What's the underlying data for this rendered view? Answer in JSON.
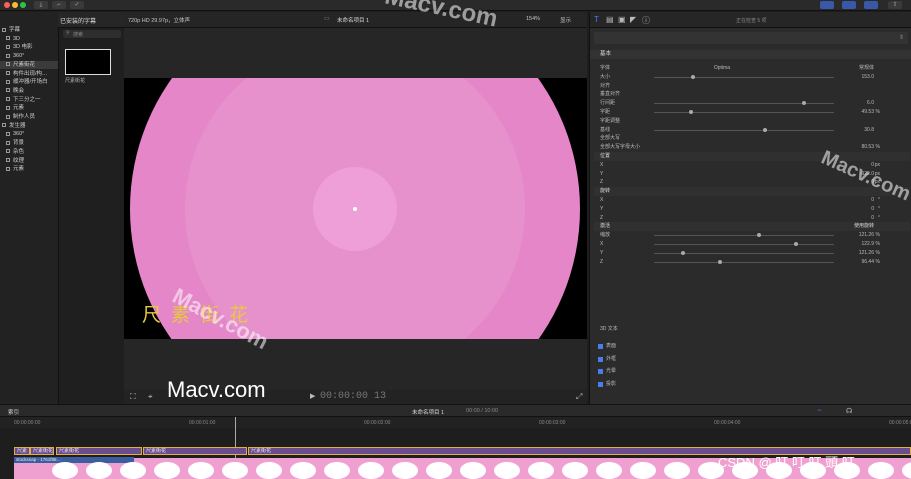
{
  "window": {
    "title": "未命名项目 1",
    "subtitle": "720p HD 29.97p，立体声",
    "zoom": "154%",
    "display_label": "显示",
    "inspector_status": "正在检查 5 项"
  },
  "browser": {
    "library_label": "已安装的字幕",
    "search_placeholder": "搜索",
    "clip_name": "尺素街花"
  },
  "sidebar": {
    "items": [
      {
        "label": "字幕",
        "selected": false,
        "indent": 0
      },
      {
        "label": "3D",
        "selected": false,
        "indent": 1
      },
      {
        "label": "3D 电影",
        "selected": false,
        "indent": 1
      },
      {
        "label": "360°",
        "selected": false,
        "indent": 1
      },
      {
        "label": "尺素街花",
        "selected": true,
        "indent": 1
      },
      {
        "label": "构件出现/构…",
        "selected": false,
        "indent": 1
      },
      {
        "label": "缓冲器/开场白",
        "selected": false,
        "indent": 1
      },
      {
        "label": "晚会",
        "selected": false,
        "indent": 1
      },
      {
        "label": "下三分之一",
        "selected": false,
        "indent": 1
      },
      {
        "label": "元素",
        "selected": false,
        "indent": 1
      },
      {
        "label": "制作人员",
        "selected": false,
        "indent": 1
      },
      {
        "label": "发生器",
        "selected": false,
        "indent": 0
      },
      {
        "label": "360°",
        "selected": false,
        "indent": 1
      },
      {
        "label": "背景",
        "selected": false,
        "indent": 1
      },
      {
        "label": "杂色",
        "selected": false,
        "indent": 1
      },
      {
        "label": "纹理",
        "selected": false,
        "indent": 1
      },
      {
        "label": "元素",
        "selected": false,
        "indent": 1
      }
    ]
  },
  "viewer": {
    "caption": "尺 素 街 花",
    "timecode": "00:00:00 13"
  },
  "inspector": {
    "section_basic": "基本",
    "rows": [
      {
        "label": "字体",
        "value": "Optima",
        "value2": "常规体"
      },
      {
        "label": "大小",
        "value": "153.0",
        "unit": ""
      },
      {
        "label": "对齐",
        "value": "",
        "unit": ""
      },
      {
        "label": "垂直对齐",
        "value": "",
        "unit": ""
      },
      {
        "label": "行间距",
        "value": "6.0",
        "unit": ""
      },
      {
        "label": "字距",
        "value": "49.53",
        "unit": "%"
      },
      {
        "label": "字距调整",
        "value": "",
        "unit": ""
      },
      {
        "label": "基线",
        "value": "30.8",
        "unit": ""
      },
      {
        "label": "全部大写",
        "value": "",
        "unit": ""
      },
      {
        "label": "全部大写字母大小",
        "value": "80.53",
        "unit": "%"
      },
      {
        "label": "位置",
        "value": "",
        "unit": ""
      },
      {
        "label": "X",
        "value": "0",
        "unit": "px"
      },
      {
        "label": "Y",
        "value": "-922.0",
        "unit": "px"
      },
      {
        "label": "Z",
        "value": "0",
        "unit": "px"
      },
      {
        "label": "旋转",
        "value": "",
        "unit": ""
      },
      {
        "label": "X",
        "value": "0",
        "unit": "°"
      },
      {
        "label": "Y",
        "value": "0",
        "unit": "°"
      },
      {
        "label": "Z",
        "value": "0",
        "unit": "°"
      },
      {
        "label": "激活",
        "value": "使用旋转",
        "unit": ""
      },
      {
        "label": "缩放",
        "value": "121.26",
        "unit": "%"
      },
      {
        "label": "X",
        "value": "122.9",
        "unit": "%"
      },
      {
        "label": "Y",
        "value": "121.26",
        "unit": "%"
      },
      {
        "label": "Z",
        "value": "96.44",
        "unit": "%"
      }
    ],
    "text3d_label": "3D 文本",
    "checks": [
      {
        "label": "表面"
      },
      {
        "label": "外框"
      },
      {
        "label": "光晕"
      },
      {
        "label": "投影"
      }
    ]
  },
  "timeline": {
    "index_label": "索引",
    "project_label": "未命名项目 1",
    "duration": "00:00 / 10:00",
    "ruler": [
      "00:00:00:00",
      "00:00:01:00",
      "00:00:02:00",
      "00:00:03:00",
      "00:00:04:00",
      "00:00:05:00"
    ],
    "clips": [
      "尺素",
      "尺素街花",
      "尺素街花",
      "尺素街花",
      "尺素街花"
    ],
    "mainclip_label": "stocksnap - 1761f88…"
  },
  "watermarks": [
    "Macv.com",
    "Macv.com",
    "Macv.com",
    "Macv.com"
  ],
  "credit": "CSDN @ 叮 叮 叮 頭 叮"
}
